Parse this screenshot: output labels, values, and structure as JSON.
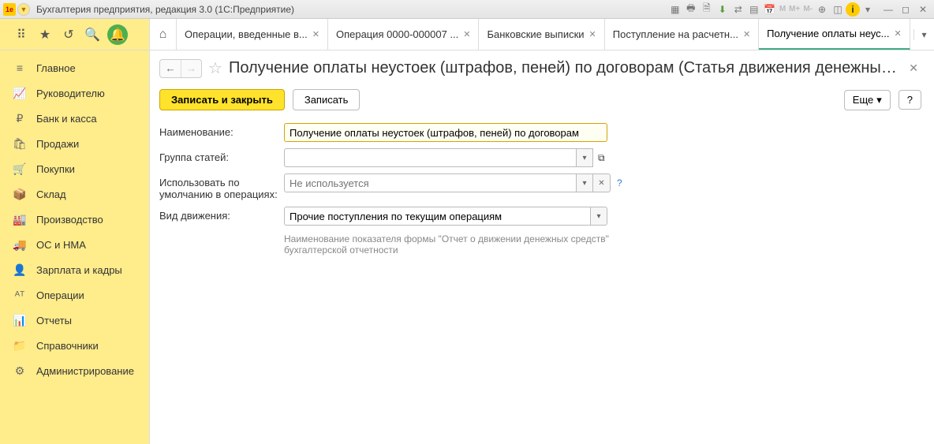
{
  "titlebar": {
    "app_title": "Бухгалтерия предприятия, редакция 3.0  (1С:Предприятие)",
    "txt_m": "M",
    "txt_mplus": "M+",
    "txt_mminus": "M-"
  },
  "tabs": {
    "items": [
      {
        "label": "Операции, введенные в..."
      },
      {
        "label": "Операция 0000-000007 ..."
      },
      {
        "label": "Банковские выписки"
      },
      {
        "label": "Поступление на расчетн..."
      },
      {
        "label": "Получение оплаты неус..."
      }
    ]
  },
  "sidebar": {
    "items": [
      {
        "label": "Главное",
        "icon": "≡"
      },
      {
        "label": "Руководителю",
        "icon": "📈"
      },
      {
        "label": "Банк и касса",
        "icon": "₽"
      },
      {
        "label": "Продажи",
        "icon": "🛍"
      },
      {
        "label": "Покупки",
        "icon": "🛒"
      },
      {
        "label": "Склад",
        "icon": "📦"
      },
      {
        "label": "Производство",
        "icon": "🏭"
      },
      {
        "label": "ОС и НМА",
        "icon": "🚚"
      },
      {
        "label": "Зарплата и кадры",
        "icon": "👤"
      },
      {
        "label": "Операции",
        "icon": "ᴬᵀ"
      },
      {
        "label": "Отчеты",
        "icon": "📊"
      },
      {
        "label": "Справочники",
        "icon": "📁"
      },
      {
        "label": "Администрирование",
        "icon": "⚙"
      }
    ]
  },
  "page": {
    "title": "Получение оплаты неустоек (штрафов, пеней) по договорам (Статья движения денежных с...",
    "actions": {
      "save_close": "Записать и закрыть",
      "save": "Записать",
      "more": "Еще",
      "help": "?"
    }
  },
  "form": {
    "name_label": "Наименование:",
    "name_value": "Получение оплаты неустоек (штрафов, пеней) по договорам",
    "group_label": "Группа статей:",
    "group_value": "",
    "default_label": "Использовать по умолчанию в операциях:",
    "default_placeholder": "Не используется",
    "movement_label": "Вид движения:",
    "movement_value": "Прочие поступления по текущим операциям",
    "movement_helper": "Наименование показателя формы \"Отчет о движении денежных средств\" бухгалтерской отчетности"
  }
}
